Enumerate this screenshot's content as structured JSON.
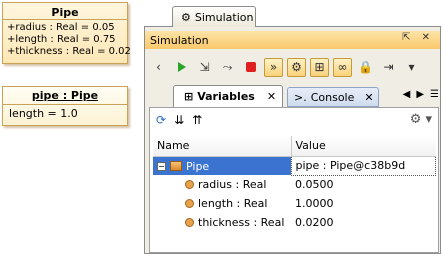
{
  "uml_class": {
    "name": "Pipe",
    "attributes": [
      "+radius : Real = 0.05",
      "+length : Real = 0.75",
      "+thickness : Real = 0.02"
    ]
  },
  "uml_instance": {
    "name": "pipe : Pipe",
    "slot": "length = 1.0"
  },
  "window": {
    "tab_label": "Simulation",
    "title": "Simulation",
    "title_controls": "⇱ ✕"
  },
  "toolbar": {
    "icons": [
      "back-icon",
      "run-icon",
      "step-into-icon",
      "step-over-icon",
      "stop-icon",
      "animation-icon",
      "settings-icon",
      "structure-icon",
      "link-icon",
      "lock-icon",
      "export-icon",
      "menu-icon"
    ]
  },
  "tabs": {
    "variables": "Variables",
    "console": "Console",
    "close": "✕"
  },
  "table": {
    "columns": [
      "Name",
      "Value"
    ],
    "rows": [
      {
        "name": "Pipe",
        "value": "pipe : Pipe@c38b9d"
      },
      {
        "name": "radius : Real",
        "value": "0.0500"
      },
      {
        "name": "length : Real",
        "value": "1.0000"
      },
      {
        "name": "thickness : Real",
        "value": "0.0200"
      }
    ]
  },
  "colors": {
    "accent": "#f9c86a",
    "selection": "#3b73d0"
  }
}
